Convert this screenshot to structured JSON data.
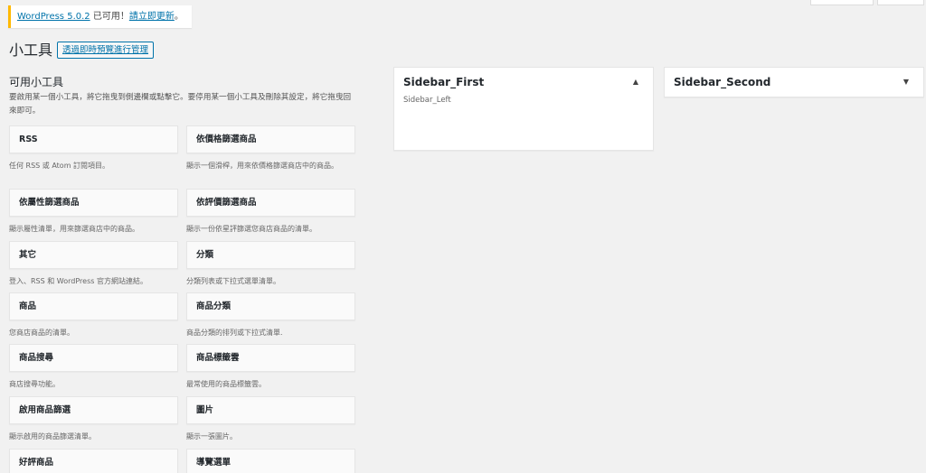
{
  "notice": {
    "version_link": "WordPress 5.0.2",
    "text_mid": " 已可用！",
    "update_link": "請立即更新",
    "text_end": "。"
  },
  "header": {
    "title": "小工具",
    "manage_button": "透過即時預覽進行管理"
  },
  "available": {
    "title": "可用小工具",
    "description": "要啟用某一個小工具，將它拖曳到側邊欄或點擊它。要停用某一個小工具及刪除其設定，將它拖曳回來即可。"
  },
  "widgets": [
    {
      "title": "RSS",
      "desc": "任何 RSS 或 Atom 訂閱項目。"
    },
    {
      "title": "依價格篩選商品",
      "desc": "顯示一個滑桿，用來依價格篩選商店中的商品。"
    },
    {
      "title": "依屬性篩選商品",
      "desc": "顯示屬性清單，用來篩選商店中的商品。"
    },
    {
      "title": "依評價篩選商品",
      "desc": "顯示一份依星評篩選您商店商品的清單。"
    },
    {
      "title": "其它",
      "desc": "登入、RSS 和 WordPress 官方網站連結。"
    },
    {
      "title": "分類",
      "desc": "分類列表或下拉式選單清單。"
    },
    {
      "title": "商品",
      "desc": "您商店商品的清單。"
    },
    {
      "title": "商品分類",
      "desc": "商品分類的排列或下拉式清單."
    },
    {
      "title": "商品搜尋",
      "desc": "商店搜尋功能。"
    },
    {
      "title": "商品標籤雲",
      "desc": "最常使用的商品標籤雲。"
    },
    {
      "title": "啟用商品篩選",
      "desc": "顯示啟用的商品篩選清單。"
    },
    {
      "title": "圖片",
      "desc": "顯示一張圖片。"
    },
    {
      "title": "好評商品",
      "desc": ""
    },
    {
      "title": "導覽選單",
      "desc": ""
    }
  ],
  "sidebars": {
    "first": {
      "title": "Sidebar_First",
      "desc": "Sidebar_Left",
      "arrow": "▲"
    },
    "second": {
      "title": "Sidebar_Second",
      "arrow": "▼"
    }
  }
}
